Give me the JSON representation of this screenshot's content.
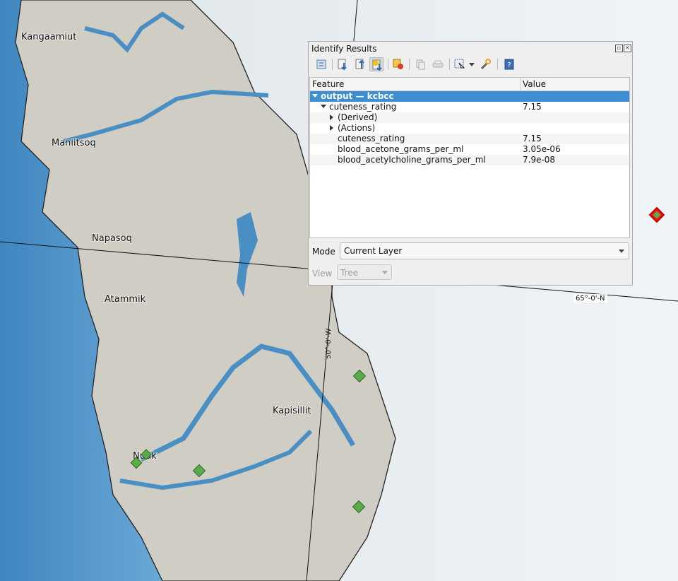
{
  "map": {
    "places": [
      "Kangaamiut",
      "Maniitsoq",
      "Napasoq",
      "Atammik",
      "Kapisillit",
      "Nuuk"
    ],
    "graticule": {
      "lat_label": "65°-0'-N",
      "lon_label": "50°-0'-W"
    }
  },
  "panel": {
    "title": "Identify Results",
    "columns": {
      "feature": "Feature",
      "value": "Value"
    },
    "rows": [
      {
        "feature": "output — kcbcc",
        "value": ""
      },
      {
        "feature": "cuteness_rating",
        "value": "7.15"
      },
      {
        "feature": "(Derived)",
        "value": ""
      },
      {
        "feature": "(Actions)",
        "value": ""
      },
      {
        "feature": "cuteness_rating",
        "value": "7.15"
      },
      {
        "feature": "blood_acetone_grams_per_ml",
        "value": "3.05e-06"
      },
      {
        "feature": "blood_acetylcholine_grams_per_ml",
        "value": "7.9e-08"
      }
    ],
    "mode": {
      "label": "Mode",
      "selected": "Current Layer"
    },
    "view": {
      "label": "View",
      "selected": "Tree"
    }
  },
  "colors": {
    "selection": "#3d8fd1",
    "sea": "#4a8fc4",
    "point": "#5aab4a",
    "highlight": "#ff0000"
  }
}
